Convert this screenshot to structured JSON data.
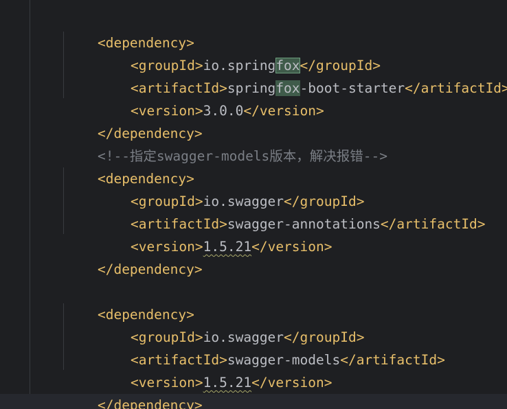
{
  "editor": {
    "language": "xml",
    "dep1": {
      "open": "<dependency>",
      "groupId_open": "<groupId>",
      "groupId_pre": "io.spring",
      "groupId_match": "fox",
      "groupId_close": "</groupId>",
      "artifactId_open": "<artifactId>",
      "artifactId_pre": "spring",
      "artifactId_match": "fox",
      "artifactId_post": "-boot-starter",
      "artifactId_close": "</artifactId>",
      "version_open": "<version>",
      "version_value": "3.0.0",
      "version_close": "</version>",
      "close": "</dependency>"
    },
    "comment": "<!--指定swagger-models版本，解决报错-->",
    "dep2": {
      "open": "<dependency>",
      "groupId_open": "<groupId>",
      "groupId_value": "io.swagger",
      "groupId_close": "</groupId>",
      "artifactId_open": "<artifactId>",
      "artifactId_value": "swagger-annotations",
      "artifactId_close": "</artifactId>",
      "version_open": "<version>",
      "version_value": "1.5.21",
      "version_close": "</version>",
      "close": "</dependency>"
    },
    "dep3": {
      "open": "<dependency>",
      "groupId_open": "<groupId>",
      "groupId_value": "io.swagger",
      "groupId_close": "</groupId>",
      "artifactId_open": "<artifactId>",
      "artifactId_value": "swagger-models",
      "artifactId_close": "</artifactId>",
      "version_open": "<version>",
      "version_value": "1.5.21",
      "version_close": "</version>",
      "close": "</dependency>"
    },
    "colors": {
      "background": "#1e1f22",
      "tag": "#e8bf6a",
      "text": "#bcbec4",
      "comment": "#7a7e85",
      "search_highlight": "#3f5b4a"
    }
  }
}
